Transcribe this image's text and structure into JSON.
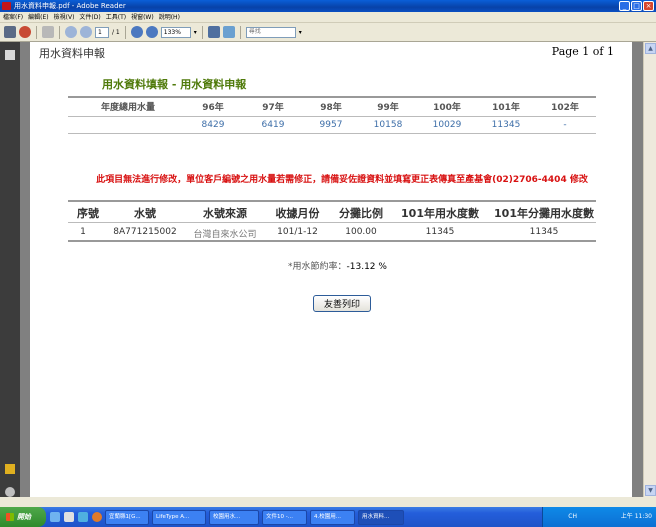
{
  "window": {
    "title": "用水資料申報.pdf - Adobe Reader"
  },
  "menu": [
    "檔案(F)",
    "編輯(E)",
    "檢視(V)",
    "文件(D)",
    "工具(T)",
    "視窗(W)",
    "說明(H)"
  ],
  "toolbar": {
    "page_current": "1",
    "page_total": "/ 1",
    "zoom": "133%",
    "find_placeholder": "尋找"
  },
  "pdf": {
    "header_left": "用水資料申報",
    "header_right": "Page 1 of 1",
    "form_title": "用水資料填報 - 用水資料申報",
    "annual_table": {
      "row_label": "年度總用水量",
      "years": [
        "96年",
        "97年",
        "98年",
        "99年",
        "100年",
        "101年",
        "102年"
      ],
      "values": [
        "8429",
        "6419",
        "9957",
        "10158",
        "10029",
        "11345",
        "-"
      ]
    },
    "warning": "此項目無法進行修改，單位客戶編號之用水量若需修正，請備妥佐證資料並填寫更正表傳真至產基會(02)2706-4404 修改",
    "detail_table": {
      "headers": [
        "序號",
        "水號",
        "水號來源",
        "收據月份",
        "分攤比例",
        "101年用水度數",
        "101年分攤用水度數"
      ],
      "row": [
        "1",
        "8A771215002",
        "台灣自來水公司",
        "101/1-12",
        "100.00",
        "11345",
        "11345"
      ]
    },
    "savings_label": "*用水節約率：",
    "savings_value": "-13.12 %",
    "print_button": "友善列印"
  },
  "taskbar": {
    "start_label": "開始",
    "tasks": [
      "宜蘭縣1[G...",
      "LifeType A...",
      "校園用水...",
      "文件10 -...",
      "4.校園用...",
      "用水資料..."
    ],
    "tray_lang": "CH",
    "clock": "上午 11:30"
  }
}
